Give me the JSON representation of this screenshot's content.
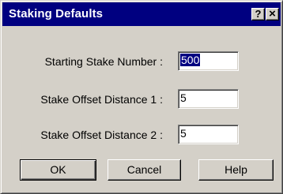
{
  "window": {
    "title": "Staking Defaults",
    "help_glyph": "?",
    "close_glyph": "×"
  },
  "fields": [
    {
      "label": "Starting Stake Number :",
      "value": "500"
    },
    {
      "label": "Stake Offset Distance 1 :",
      "value": "5"
    },
    {
      "label": "Stake Offset Distance 2 :",
      "value": "5"
    }
  ],
  "buttons": {
    "ok": "OK",
    "cancel": "Cancel",
    "help": "Help"
  },
  "colors": {
    "titlebar": "#000080",
    "face": "#d4d0c8",
    "selection": "#000080"
  }
}
